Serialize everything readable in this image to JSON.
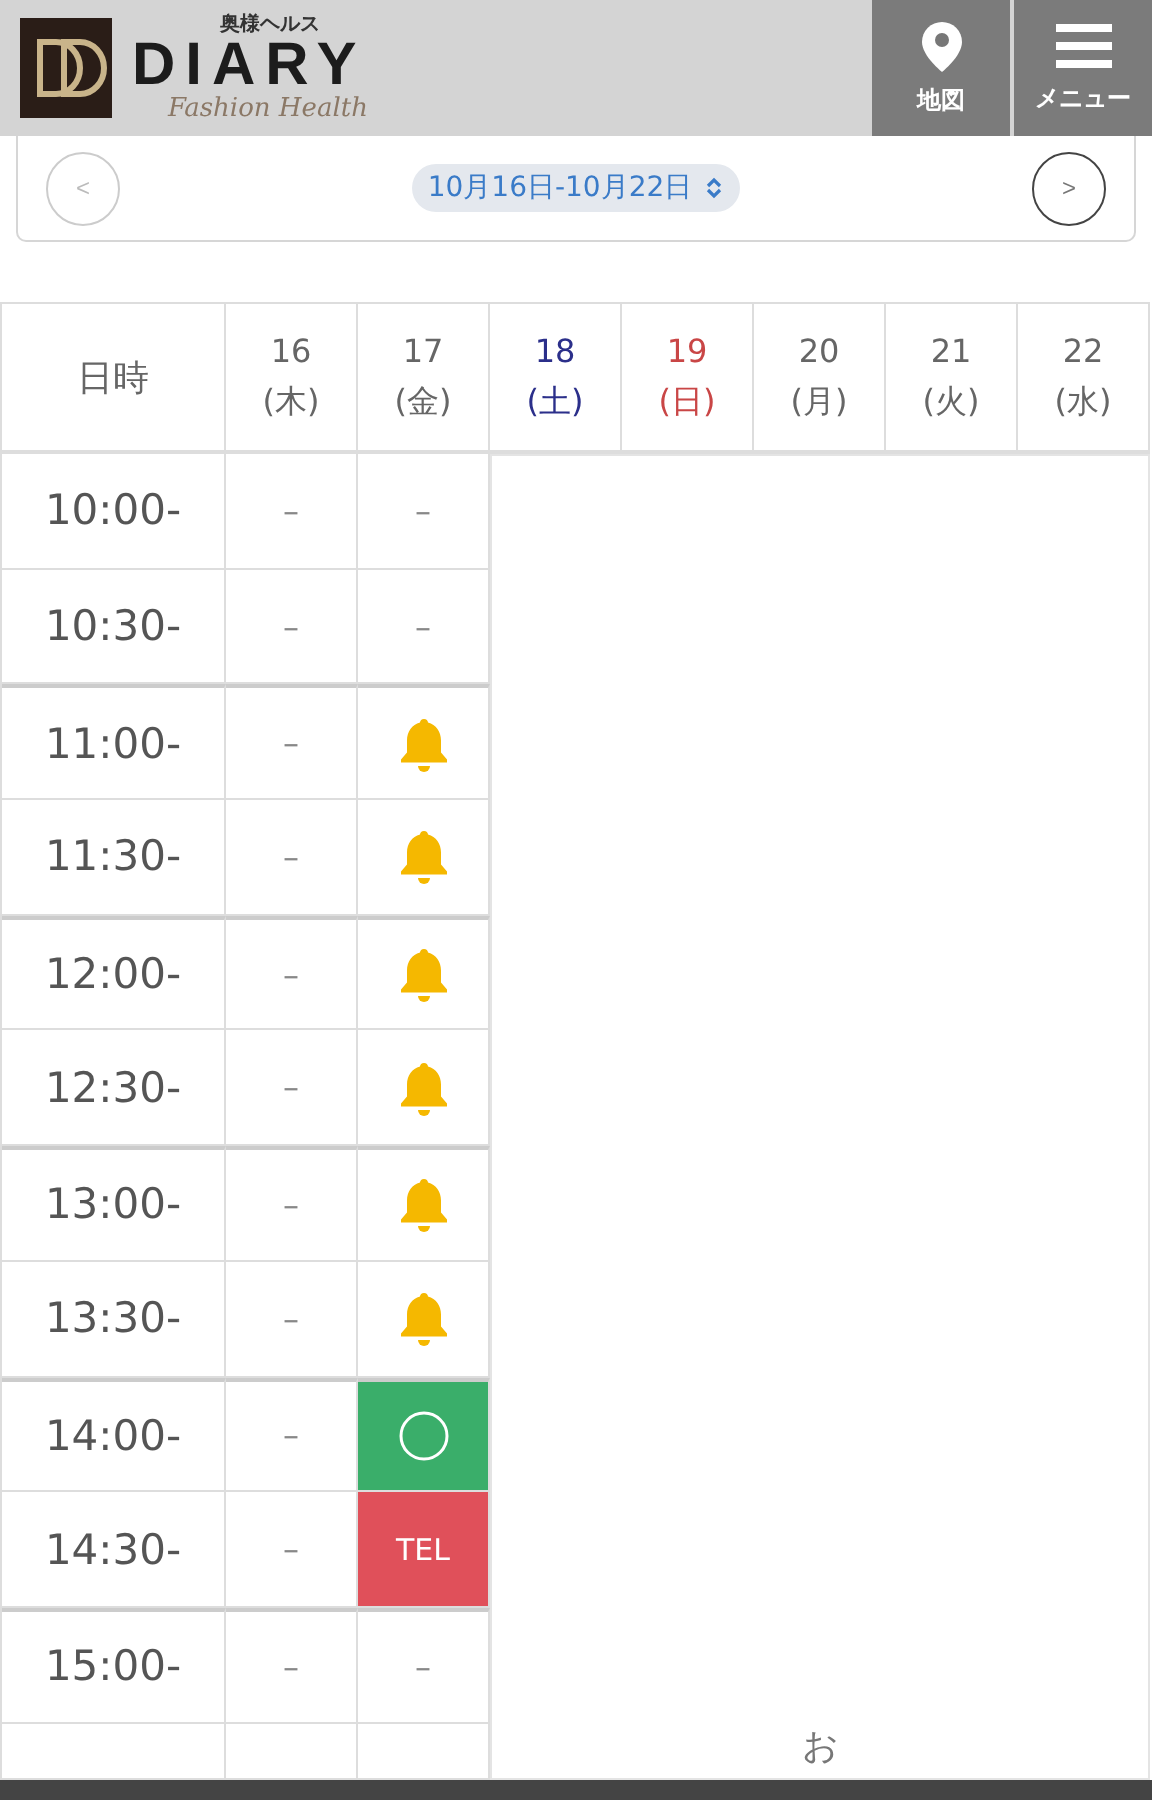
{
  "header": {
    "tagline": "奥様ヘルス",
    "brand": "DIARY",
    "subtitle": "Fashion Health",
    "buttons": [
      {
        "kind": "map",
        "label": "地図"
      },
      {
        "kind": "menu",
        "label": "メニュー"
      }
    ]
  },
  "week_nav": {
    "prev": "<",
    "range": "10月16日-10月22日",
    "next": ">"
  },
  "table": {
    "corner": "日時",
    "days": [
      {
        "date": "16",
        "weekday": "(木)",
        "kind": "weekday"
      },
      {
        "date": "17",
        "weekday": "(金)",
        "kind": "weekday"
      },
      {
        "date": "18",
        "weekday": "(土)",
        "kind": "saturday"
      },
      {
        "date": "19",
        "weekday": "(日)",
        "kind": "sunday"
      },
      {
        "date": "20",
        "weekday": "(月)",
        "kind": "weekday"
      },
      {
        "date": "21",
        "weekday": "(火)",
        "kind": "weekday"
      },
      {
        "date": "22",
        "weekday": "(水)",
        "kind": "weekday"
      }
    ],
    "rows": [
      {
        "time": "10:00-",
        "cells": [
          {
            "kind": "dash",
            "text": "–"
          },
          {
            "kind": "dash",
            "text": "–"
          }
        ]
      },
      {
        "time": "10:30-",
        "cells": [
          {
            "kind": "dash",
            "text": "–"
          },
          {
            "kind": "dash",
            "text": "–"
          }
        ]
      },
      {
        "time": "11:00-",
        "cells": [
          {
            "kind": "dash",
            "text": "–"
          },
          {
            "kind": "bell"
          }
        ]
      },
      {
        "time": "11:30-",
        "cells": [
          {
            "kind": "dash",
            "text": "–"
          },
          {
            "kind": "bell"
          }
        ]
      },
      {
        "time": "12:00-",
        "cells": [
          {
            "kind": "dash",
            "text": "–"
          },
          {
            "kind": "bell"
          }
        ]
      },
      {
        "time": "12:30-",
        "cells": [
          {
            "kind": "dash",
            "text": "–"
          },
          {
            "kind": "bell"
          }
        ]
      },
      {
        "time": "13:00-",
        "cells": [
          {
            "kind": "dash",
            "text": "–"
          },
          {
            "kind": "bell"
          }
        ]
      },
      {
        "time": "13:30-",
        "cells": [
          {
            "kind": "dash",
            "text": "–"
          },
          {
            "kind": "bell"
          }
        ]
      },
      {
        "time": "14:00-",
        "cells": [
          {
            "kind": "dash",
            "text": "–"
          },
          {
            "kind": "open"
          }
        ]
      },
      {
        "time": "14:30-",
        "cells": [
          {
            "kind": "dash",
            "text": "–"
          },
          {
            "kind": "tel",
            "text": "TEL"
          }
        ]
      },
      {
        "time": "15:00-",
        "cells": [
          {
            "kind": "dash",
            "text": "–"
          },
          {
            "kind": "dash",
            "text": "–"
          }
        ]
      }
    ],
    "closed_note": "お"
  }
}
